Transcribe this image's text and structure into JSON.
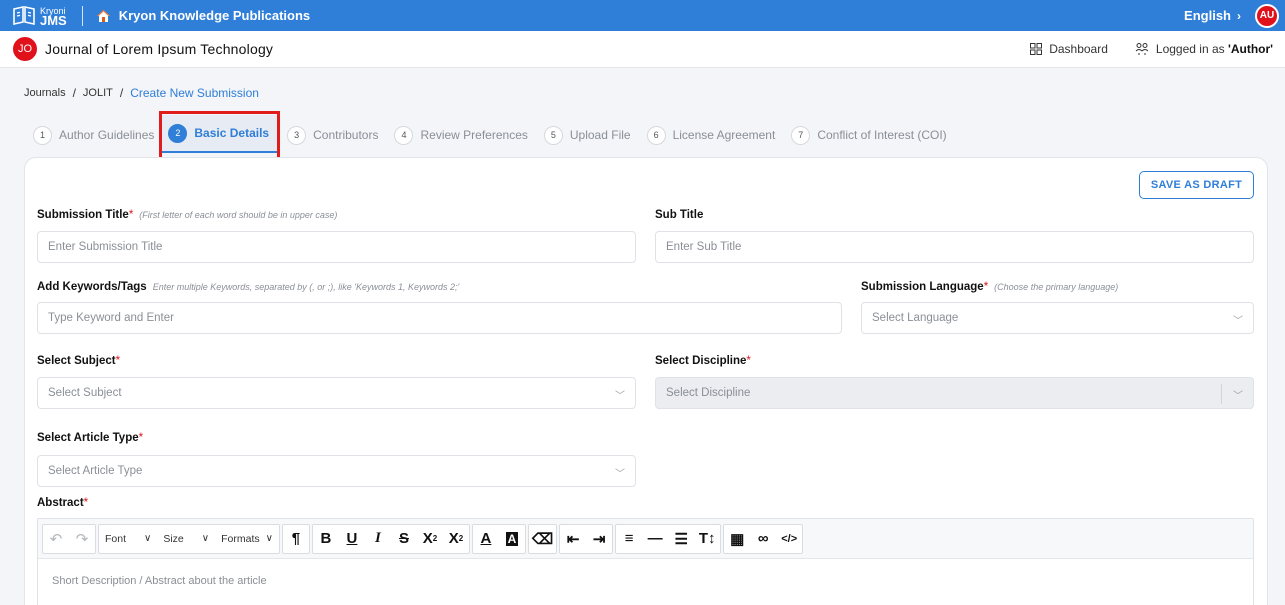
{
  "topbar": {
    "logo_small": "Kryoni",
    "logo_big": "JMS",
    "publisher": "Kryon Knowledge Publications",
    "language": "English",
    "avatar": "AU",
    "colors": {
      "bar": "#2f7ed8",
      "avatar": "#e0111b"
    }
  },
  "journalbar": {
    "badge": "JO",
    "title": "Journal of Lorem Ipsum Technology",
    "dashboard": "Dashboard",
    "logged_prefix": "Logged in as ",
    "logged_role": "'Author'"
  },
  "breadcrumb": {
    "items": [
      "Journals",
      "JOLIT",
      "Create New Submission"
    ]
  },
  "steps": [
    {
      "num": "1",
      "label": "Author Guidelines"
    },
    {
      "num": "2",
      "label": "Basic Details",
      "active": true
    },
    {
      "num": "3",
      "label": "Contributors"
    },
    {
      "num": "4",
      "label": "Review Preferences"
    },
    {
      "num": "5",
      "label": "Upload File"
    },
    {
      "num": "6",
      "label": "License Agreement"
    },
    {
      "num": "7",
      "label": "Conflict of Interest (COI)"
    }
  ],
  "form": {
    "save_draft": "SAVE AS DRAFT",
    "submission_title": {
      "label": "Submission Title",
      "hint": "(First letter of each word should be in upper case)",
      "placeholder": "Enter Submission Title"
    },
    "sub_title": {
      "label": "Sub Title",
      "placeholder": "Enter Sub Title"
    },
    "keywords": {
      "label": "Add Keywords/Tags",
      "hint": "Enter multiple Keywords, separated by (, or ;), like 'Keywords 1, Keywords 2;'",
      "placeholder": "Type Keyword and Enter"
    },
    "language": {
      "label": "Submission Language",
      "hint": "(Choose the primary language)",
      "placeholder": "Select Language"
    },
    "subject": {
      "label": "Select Subject",
      "placeholder": "Select Subject"
    },
    "discipline": {
      "label": "Select Discipline",
      "placeholder": "Select Discipline"
    },
    "article_type": {
      "label": "Select Article Type",
      "placeholder": "Select Article Type"
    },
    "abstract": {
      "label": "Abstract",
      "placeholder": "Short Description / Abstract about the article"
    },
    "required_mark": "*"
  },
  "editor_toolbar": {
    "font": "Font",
    "size": "Size",
    "formats": "Formats"
  }
}
